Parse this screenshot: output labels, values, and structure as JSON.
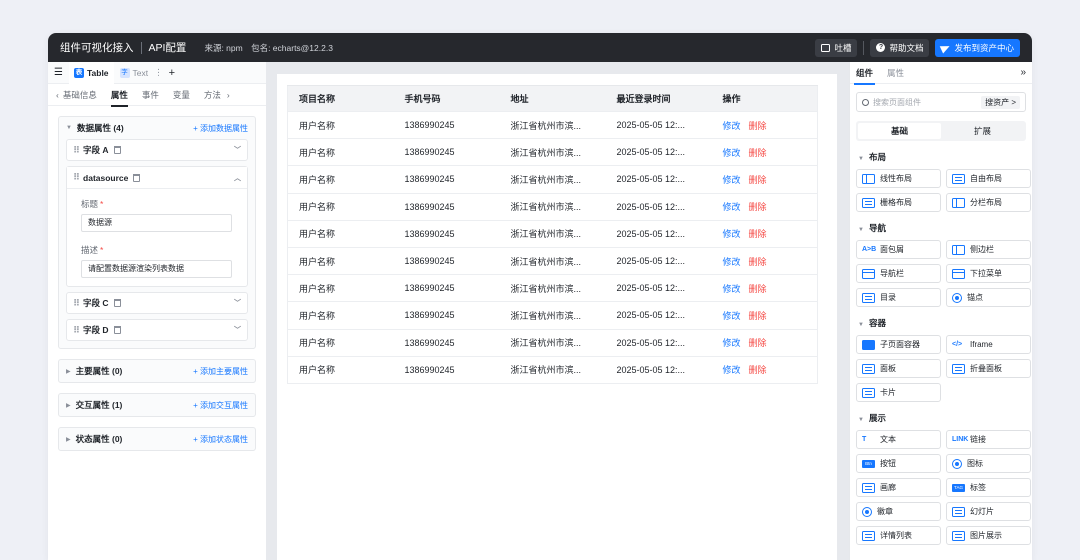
{
  "topbar": {
    "title": "组件可视化接入",
    "subtitle": "API配置",
    "source": "来源: npm",
    "package": "包名: echarts@12.2.3",
    "feedback_label": "吐槽",
    "help_label": "帮助文档",
    "publish_label": "发布到资产中心"
  },
  "left": {
    "tabs": [
      {
        "icon": "表",
        "label": "Table"
      },
      {
        "icon": "字",
        "label": "Text"
      }
    ],
    "add_tab": "+",
    "subtabs": [
      "基础信息",
      "属性",
      "事件",
      "变量",
      "方法"
    ],
    "prev": "‹",
    "next": "›",
    "data_group": {
      "title": "数据属性 (4)",
      "add": "+ 添加数据属性"
    },
    "fields": {
      "a": "字段 A",
      "datasource": "datasource",
      "c": "字段 C",
      "d": "字段 D"
    },
    "datasource_props": {
      "title_label": "标题",
      "title_value": "数据源",
      "desc_label": "描述",
      "desc_value": "请配置数据源渲染列表数据"
    },
    "groups": [
      {
        "title": "主要属性 (0)",
        "add": "+ 添加主要属性"
      },
      {
        "title": "交互属性 (1)",
        "add": "+ 添加交互属性"
      },
      {
        "title": "状态属性 (0)",
        "add": "+ 添加状态属性"
      }
    ]
  },
  "table": {
    "headers": [
      "项目名称",
      "手机号码",
      "地址",
      "最近登录时间",
      "操作"
    ],
    "rows": [
      {
        "name": "用户名称",
        "phone": "1386990245",
        "addr": "浙江省杭州市滨...",
        "time": "2025-05-05 12:..."
      },
      {
        "name": "用户名称",
        "phone": "1386990245",
        "addr": "浙江省杭州市滨...",
        "time": "2025-05-05 12:..."
      },
      {
        "name": "用户名称",
        "phone": "1386990245",
        "addr": "浙江省杭州市滨...",
        "time": "2025-05-05 12:..."
      },
      {
        "name": "用户名称",
        "phone": "1386990245",
        "addr": "浙江省杭州市滨...",
        "time": "2025-05-05 12:..."
      },
      {
        "name": "用户名称",
        "phone": "1386990245",
        "addr": "浙江省杭州市滨...",
        "time": "2025-05-05 12:..."
      },
      {
        "name": "用户名称",
        "phone": "1386990245",
        "addr": "浙江省杭州市滨...",
        "time": "2025-05-05 12:..."
      },
      {
        "name": "用户名称",
        "phone": "1386990245",
        "addr": "浙江省杭州市滨...",
        "time": "2025-05-05 12:..."
      },
      {
        "name": "用户名称",
        "phone": "1386990245",
        "addr": "浙江省杭州市滨...",
        "time": "2025-05-05 12:..."
      },
      {
        "name": "用户名称",
        "phone": "1386990245",
        "addr": "浙江省杭州市滨...",
        "time": "2025-05-05 12:..."
      },
      {
        "name": "用户名称",
        "phone": "1386990245",
        "addr": "浙江省杭州市滨...",
        "time": "2025-05-05 12:..."
      }
    ],
    "edit_label": "修改",
    "delete_label": "删除"
  },
  "right": {
    "tabs": [
      "组件",
      "属性"
    ],
    "collapse": "»",
    "search_placeholder": "搜索页面组件",
    "store_label": "搜资产 >",
    "segments": [
      "基础",
      "扩展"
    ],
    "categories": [
      {
        "title": "布局",
        "items": [
          {
            "label": "线性布局",
            "icon": "split"
          },
          {
            "label": "自由布局",
            "icon": "lines"
          },
          {
            "label": "栅格布局",
            "icon": "lines"
          },
          {
            "label": "分栏布局",
            "icon": "split"
          }
        ]
      },
      {
        "title": "导航",
        "items": [
          {
            "label": "面包屑",
            "icon": "txt",
            "text": "A>B"
          },
          {
            "label": "侧边栏",
            "icon": "split"
          },
          {
            "label": "导航栏",
            "icon": "bar"
          },
          {
            "label": "下拉菜单",
            "icon": "bar"
          },
          {
            "label": "目录",
            "icon": "lines"
          },
          {
            "label": "锚点",
            "icon": "circ"
          }
        ]
      },
      {
        "title": "容器",
        "items": [
          {
            "label": "子页面容器",
            "icon": "fill"
          },
          {
            "label": "Iframe",
            "icon": "txt",
            "text": "</>"
          },
          {
            "label": "面板",
            "icon": "lines"
          },
          {
            "label": "折叠面板",
            "icon": "lines"
          },
          {
            "label": "卡片",
            "icon": "lines"
          }
        ]
      },
      {
        "title": "展示",
        "items": [
          {
            "label": "文本",
            "icon": "txt",
            "text": "T"
          },
          {
            "label": "链接",
            "icon": "txt",
            "text": "LINK"
          },
          {
            "label": "按钮",
            "icon": "tag",
            "text": "Btn"
          },
          {
            "label": "图标",
            "icon": "circ"
          },
          {
            "label": "画廊",
            "icon": "lines"
          },
          {
            "label": "标签",
            "icon": "tag",
            "text": "TAG"
          },
          {
            "label": "徽章",
            "icon": "circ"
          },
          {
            "label": "幻灯片",
            "icon": "lines"
          },
          {
            "label": "详情列表",
            "icon": "lines"
          },
          {
            "label": "图片展示",
            "icon": "lines"
          }
        ]
      }
    ]
  }
}
